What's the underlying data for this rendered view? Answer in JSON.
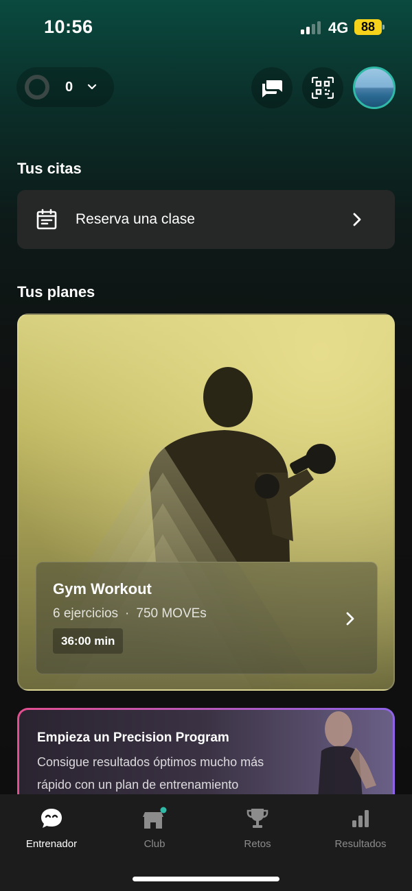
{
  "status_bar": {
    "time": "10:56",
    "network": "4G",
    "battery": "88"
  },
  "header": {
    "moves_count": "0"
  },
  "appointments": {
    "title": "Tus citas",
    "book_label": "Reserva una clase"
  },
  "plans": {
    "title": "Tus planes",
    "card": {
      "title": "Gym Workout",
      "exercises": "6 ejercicios",
      "moves": "750 MOVEs",
      "duration": "36:00 min"
    }
  },
  "precision": {
    "title": "Empieza un Precision Program",
    "description": "Consigue resultados óptimos mucho más rápido con un plan de entrenamiento"
  },
  "nav": {
    "items": [
      {
        "label": "Entrenador",
        "icon": "coach-icon",
        "active": true
      },
      {
        "label": "Club",
        "icon": "club-icon",
        "badge": true
      },
      {
        "label": "Retos",
        "icon": "trophy-icon"
      },
      {
        "label": "Resultados",
        "icon": "bar-chart-icon"
      }
    ]
  },
  "colors": {
    "accent": "#2fb9a6",
    "battery": "#f6d21a",
    "precision_gradient": [
      "#e24f8f",
      "#8e63e6"
    ]
  }
}
